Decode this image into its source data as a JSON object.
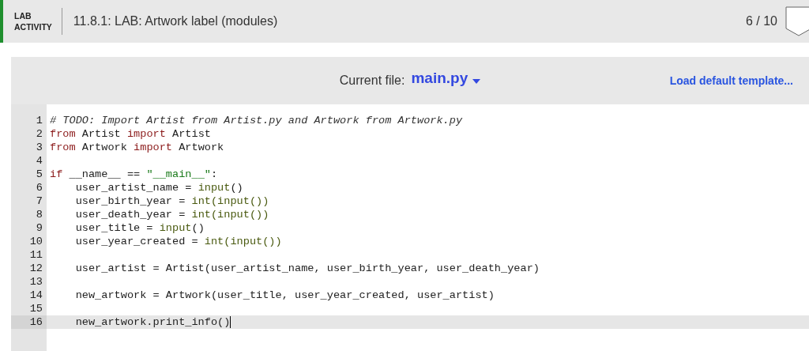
{
  "header": {
    "badge_lines": [
      "LAB",
      "ACTIVITY"
    ],
    "title": "11.8.1: LAB: Artwork label (modules)",
    "progress": "6 / 10"
  },
  "toolbar": {
    "file_label": "Current file:",
    "file_name": "main.py",
    "load_link": "Load default template..."
  },
  "editor": {
    "lines": [
      {
        "number": "1",
        "selected": false,
        "tokens": [
          {
            "kind": "comment",
            "text": "# TODO: Import Artist from Artist.py and Artwork from Artwork.py"
          }
        ]
      },
      {
        "number": "2",
        "selected": false,
        "tokens": [
          {
            "kind": "keyword",
            "text": "from"
          },
          {
            "kind": "plain",
            "text": " Artist "
          },
          {
            "kind": "keyword",
            "text": "import"
          },
          {
            "kind": "plain",
            "text": " Artist"
          }
        ]
      },
      {
        "number": "3",
        "selected": false,
        "tokens": [
          {
            "kind": "keyword",
            "text": "from"
          },
          {
            "kind": "plain",
            "text": " Artwork "
          },
          {
            "kind": "keyword",
            "text": "import"
          },
          {
            "kind": "plain",
            "text": " Artwork"
          }
        ]
      },
      {
        "number": "4",
        "selected": false
      },
      {
        "number": "5",
        "selected": false,
        "tokens": [
          {
            "kind": "keyword",
            "text": "if"
          },
          {
            "kind": "plain",
            "text": " __name__ == "
          },
          {
            "kind": "string",
            "text": "\"__main__\""
          },
          {
            "kind": "plain",
            "text": ":"
          }
        ]
      },
      {
        "number": "6",
        "selected": false,
        "tokens": [
          {
            "kind": "plain",
            "text": "    user_artist_name = "
          },
          {
            "kind": "builtin",
            "text": "input"
          },
          {
            "kind": "plain",
            "text": "()"
          }
        ]
      },
      {
        "number": "7",
        "selected": false,
        "tokens": [
          {
            "kind": "plain",
            "text": "    user_birth_year = "
          },
          {
            "kind": "builtin",
            "text": "int(input())"
          }
        ]
      },
      {
        "number": "8",
        "selected": false,
        "tokens": [
          {
            "kind": "plain",
            "text": "    user_death_year = "
          },
          {
            "kind": "builtin",
            "text": "int(input())"
          }
        ]
      },
      {
        "number": "9",
        "selected": false,
        "tokens": [
          {
            "kind": "plain",
            "text": "    user_title = "
          },
          {
            "kind": "builtin",
            "text": "input"
          },
          {
            "kind": "plain",
            "text": "()"
          }
        ]
      },
      {
        "number": "10",
        "selected": false,
        "tokens": [
          {
            "kind": "plain",
            "text": "    user_year_created = "
          },
          {
            "kind": "builtin",
            "text": "int(input())"
          }
        ]
      },
      {
        "number": "11",
        "selected": false
      },
      {
        "number": "12",
        "selected": false,
        "tokens": [
          {
            "kind": "plain",
            "text": "    user_artist = Artist(user_artist_name, user_birth_year, user_death_year)"
          }
        ]
      },
      {
        "number": "13",
        "selected": false
      },
      {
        "number": "14",
        "selected": false,
        "tokens": [
          {
            "kind": "plain",
            "text": "    new_artwork = Artwork(user_title, user_year_created, user_artist)"
          }
        ]
      },
      {
        "number": "15",
        "selected": false
      },
      {
        "number": "16",
        "selected": true,
        "tokens": [
          {
            "kind": "plain",
            "text": "    new_artwork.print_info()"
          }
        ]
      }
    ]
  }
}
